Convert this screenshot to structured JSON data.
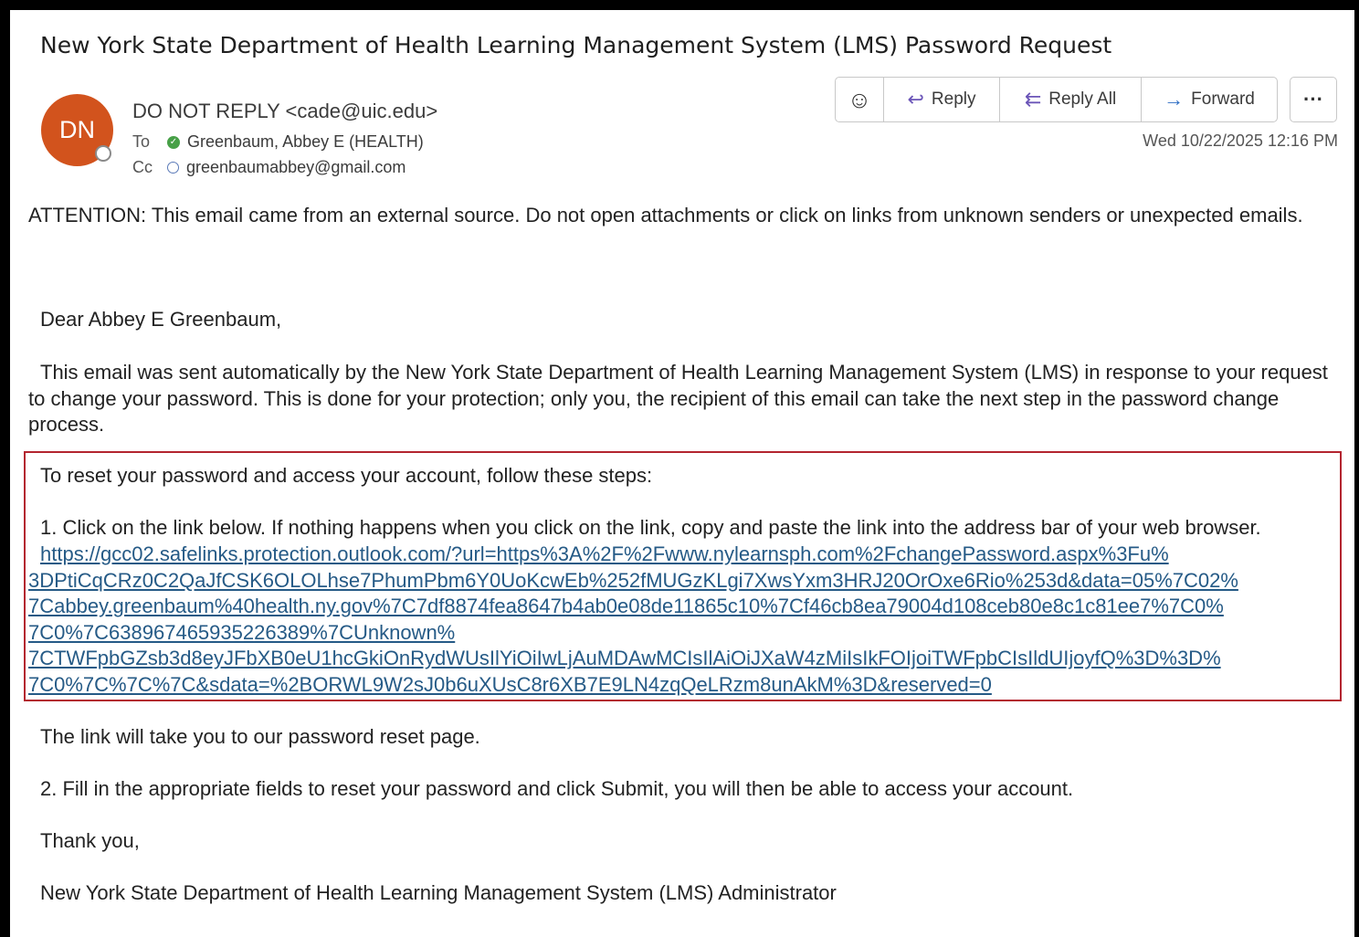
{
  "email": {
    "subject": "New York State Department of Health Learning Management System (LMS) Password Request",
    "avatar_initials": "DN",
    "from": "DO NOT REPLY <cade@uic.edu>",
    "to_label": "To",
    "to_value": "Greenbaum, Abbey E (HEALTH)",
    "cc_label": "Cc",
    "cc_value": "greenbaumabbey@gmail.com",
    "date": "Wed 10/22/2025 12:16 PM"
  },
  "toolbar": {
    "emoji_icon": "☺",
    "reply_icon": "↩",
    "reply_label": "Reply",
    "reply_all_icon": "⇇",
    "reply_all_label": "Reply All",
    "forward_icon": "→",
    "forward_label": "Forward",
    "more_label": "···"
  },
  "body": {
    "attention": "ATTENTION: This email came from an external source. Do not open attachments or click on links from unknown senders or unexpected emails.",
    "greeting": "Dear Abbey E Greenbaum,",
    "intro": "This email was sent automatically by the New York State Department of Health Learning Management System (LMS) in response to your request to change your password. This is done for your protection; only you, the recipient of this email can take the next step in the password change process.",
    "steps_intro": "To reset your password and access your account, follow these steps:",
    "step1": "1. Click on the link below. If nothing happens when you click on the link, copy and paste the link into the address bar of your web browser.",
    "link_lines": [
      "https://gcc02.safelinks.protection.outlook.com/?url=https%3A%2F%2Fwww.nylearnsph.com%2FchangePassword.aspx%3Fu%",
      "3DPtiCqCRz0C2QaJfCSK6OLOLhse7PhumPbm6Y0UoKcwEb%252fMUGzKLgi7XwsYxm3HRJ20OrOxe6Rio%253d&data=05%7C02%",
      "7Cabbey.greenbaum%40health.ny.gov%7C7df8874fea8647b4ab0e08de11865c10%7Cf46cb8ea79004d108ceb80e8c1c81ee7%7C0%",
      "7C0%7C638967465935226389%7CUnknown%",
      "7CTWFpbGZsb3d8eyJFbXB0eU1hcGkiOnRydWUsIlYiOiIwLjAuMDAwMCIsIlAiOiJXaW4zMiIsIkFOIjoiTWFpbCIsIldUIjoyfQ%3D%3D%",
      "7C0%7C%7C%7C&sdata=%2BORWL9W2sJ0b6uXUsC8r6XB7E9LN4zqQeLRzm8unAkM%3D&reserved=0"
    ],
    "link_note": "The link will take you to our password reset page.",
    "step2": "2. Fill in the appropriate fields to reset your password and click Submit, you will then be able to access your account.",
    "thanks": "Thank you,",
    "signature": "New York State Department of Health Learning Management System (LMS) Administrator"
  },
  "colors": {
    "avatar": "#d2531d",
    "highlight_border": "#b3242f",
    "link": "#255a86",
    "toolbar_icon": "#6b55b8"
  }
}
